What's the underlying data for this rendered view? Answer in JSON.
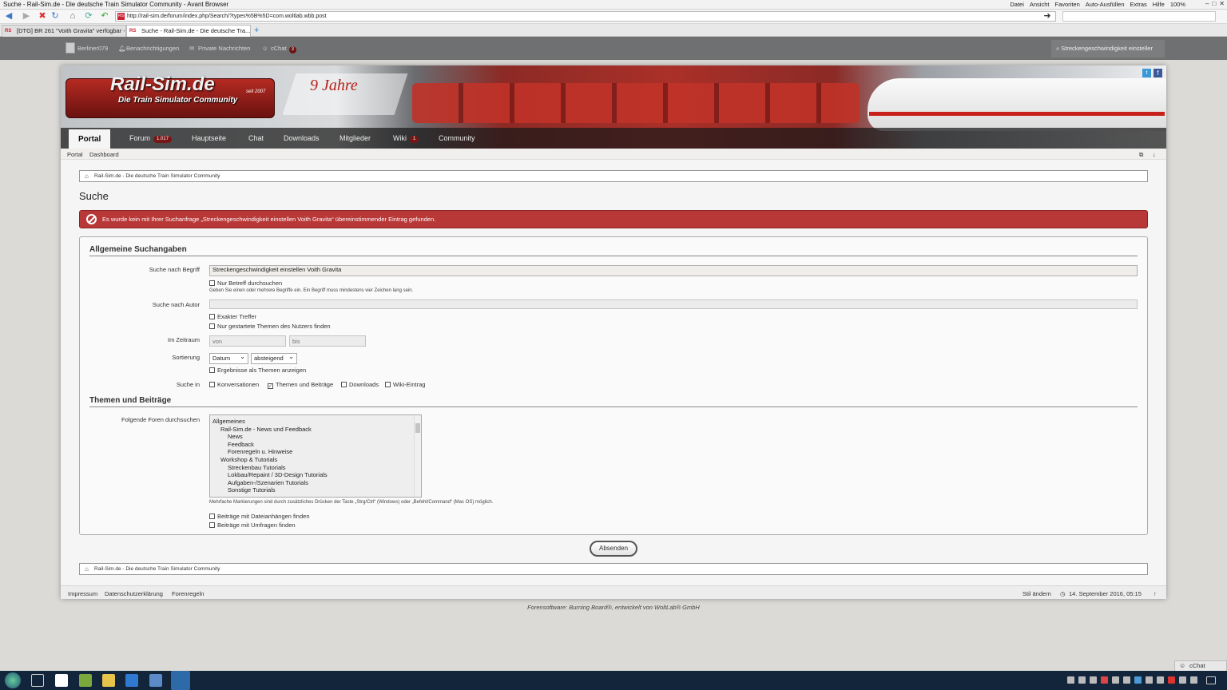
{
  "browser": {
    "title": "Suche - Rail-Sim.de - Die deutsche Train Simulator Community - Avant Browser",
    "menus": [
      "Datei",
      "Ansicht",
      "Favoriten",
      "Auto-Ausfüllen",
      "Extras",
      "Hilfe",
      "100%"
    ],
    "url": "http://rail-sim.de/forum/index.php/Search/?types%5B%5D=com.woltlab.wbb.post",
    "tabs": [
      {
        "label": "[DTG] BR 261 \"Voith Gravita\" verfügbar - ..."
      },
      {
        "label": "Suche - Rail-Sim.de - Die deutsche Tra..."
      }
    ]
  },
  "userbar": {
    "username": "Berliner079",
    "notifications": "Benachrichtigungen",
    "messages": "Private Nachrichten",
    "chat": "cChat",
    "chat_count": "3",
    "search_value": "Streckengeschwindigkeit einsteller"
  },
  "nav": {
    "items": [
      {
        "label": "Portal"
      },
      {
        "label": "Forum",
        "badge": "1.017"
      },
      {
        "label": "Hauptseite"
      },
      {
        "label": "Chat"
      },
      {
        "label": "Downloads"
      },
      {
        "label": "Mitglieder"
      },
      {
        "label": "Wiki",
        "badge": "1"
      },
      {
        "label": "Community"
      }
    ],
    "subnav": [
      "Portal",
      "Dashboard"
    ]
  },
  "banner": {
    "logo": "Rail-Sim.de",
    "tagline": "Die Train Simulator Community",
    "since": "seit 2007",
    "anniversary": "9 Jahre"
  },
  "breadcrumb": "Rail-Sim.de - Die deutsche Train Simulator Community",
  "page_title": "Suche",
  "error": "Es wurde kein mit Ihrer Suchanfrage „Streckengeschwindigkeit einstellen Voith Gravita“ übereinstimmender Eintrag gefunden.",
  "form": {
    "section1": "Allgemeine Suchangaben",
    "search_term_label": "Suche nach Begriff",
    "search_term_value": "Streckengeschwindigkeit einstellen Voith Gravita",
    "subject_only": "Nur Betreff durchsuchen",
    "term_hint": "Geben Sie einen oder mehrere Begriffe ein. Ein Begriff muss mindestens vier Zeichen lang sein.",
    "author_label": "Suche nach Autor",
    "exact_match": "Exakter Treffer",
    "only_started": "Nur gestartete Themen des Nutzers finden",
    "period_label": "Im Zeitraum",
    "from_placeholder": "von",
    "to_placeholder": "bis",
    "sort_label": "Sortierung",
    "sort_field": "Datum",
    "sort_order": "absteigend",
    "show_as_threads": "Ergebnisse als Themen anzeigen",
    "search_in_label": "Suche in",
    "search_in": [
      {
        "label": "Konversationen",
        "checked": false
      },
      {
        "label": "Themen und Beiträge",
        "checked": true
      },
      {
        "label": "Downloads",
        "checked": false
      },
      {
        "label": "Wiki-Eintrag",
        "checked": false
      }
    ],
    "section2": "Themen und Beiträge",
    "forums_label": "Folgende Foren durchsuchen",
    "forums": [
      {
        "label": "Allgemeines",
        "level": 0
      },
      {
        "label": "Rail-Sim.de - News und Feedback",
        "level": 1
      },
      {
        "label": "News",
        "level": 2
      },
      {
        "label": "Feedback",
        "level": 2
      },
      {
        "label": "Forenregeln u. Hinweise",
        "level": 2
      },
      {
        "label": "Workshop & Tutorials",
        "level": 1
      },
      {
        "label": "Streckenbau Tutorials",
        "level": 2
      },
      {
        "label": "Lokbau/Repaint / 3D-Design Tutorials",
        "level": 2
      },
      {
        "label": "Aufgaben-/Szenarien Tutorials",
        "level": 2
      },
      {
        "label": "Sonstige Tutorials",
        "level": 2
      }
    ],
    "forums_hint": "Mehrfache Markierungen sind durch zusätzliches Drücken der Taste „Strg/Ctrl“ (Windows) oder „Befehl/Command“ (Mac OS) möglich.",
    "attachments": "Beiträge mit Dateianhängen finden",
    "polls": "Beiträge mit Umfragen finden",
    "submit": "Absenden"
  },
  "footer": {
    "links": [
      "Impressum",
      "Datenschutzerklärung",
      "Forenregeln"
    ],
    "style": "Stil ändern",
    "datetime": "14. September 2016, 05:15",
    "credit": "Forensoftware: Burning Board®, entwickelt von WoltLab® GmbH"
  },
  "taskbar": {
    "cchat": "cChat"
  }
}
